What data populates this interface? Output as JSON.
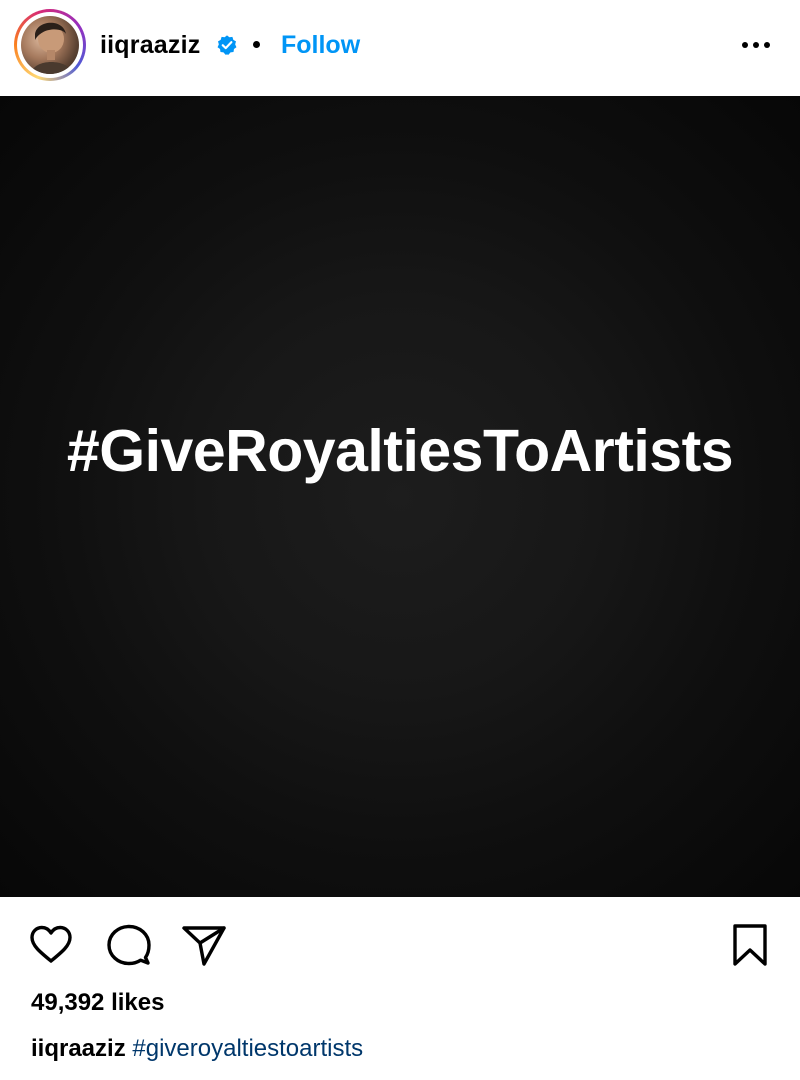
{
  "header": {
    "username": "iiqraaziz",
    "verified": true,
    "separator": "•",
    "follow_label": "Follow",
    "more_label": "More options"
  },
  "post": {
    "image_text": "#GiveRoyaltiesToArtists"
  },
  "actions": {
    "like_icon": "heart-outline-icon",
    "comment_icon": "speech-bubble-icon",
    "share_icon": "paper-plane-icon",
    "save_icon": "bookmark-outline-icon"
  },
  "engagement": {
    "likes_text": "49,392 likes"
  },
  "caption": {
    "username": "iiqraaziz",
    "hashtag": "#giveroyaltiestoartists"
  },
  "colors": {
    "accent": "#0095f6",
    "hashtag": "#00376b",
    "image_background": "#0f0f0f",
    "text": "#000000"
  }
}
